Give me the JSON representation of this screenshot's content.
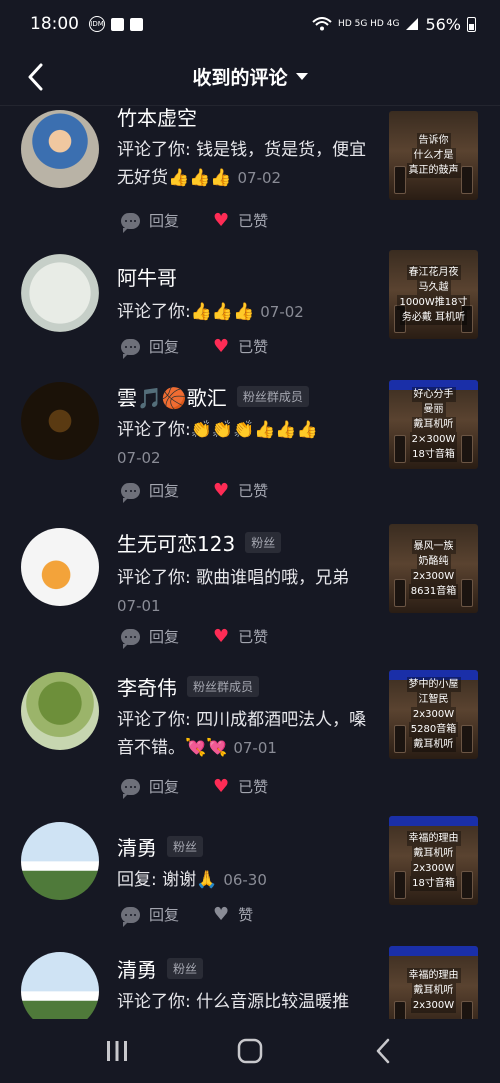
{
  "status_bar": {
    "time": "18:00",
    "network": "HD 5G HD 4G",
    "battery": "56%"
  },
  "header": {
    "title": "收到的评论"
  },
  "comments": [
    {
      "username": "竹本虚空",
      "tag": "",
      "text": "评论了你: 钱是钱，货是货，便宜无好货",
      "emoji": "👍👍👍",
      "date": "07-02",
      "reply_label": "回复",
      "like_label": "已赞",
      "liked": true,
      "thumb_lines": [
        "告诉你",
        "什么才是",
        "真正的鼓声"
      ]
    },
    {
      "username": "阿牛哥",
      "tag": "",
      "text": "评论了你:",
      "emoji": "👍👍👍",
      "date": "07-02",
      "reply_label": "回复",
      "like_label": "已赞",
      "liked": true,
      "thumb_lines": [
        "春江花月夜",
        "马久越",
        "1000W推18寸",
        "务必戴  耳机听"
      ]
    },
    {
      "username": "雲🎵🏀歌汇",
      "tag": "粉丝群成员",
      "text": "评论了你:",
      "emoji": "👏👏👏👍👍👍",
      "date": "07-02",
      "reply_label": "回复",
      "like_label": "已赞",
      "liked": true,
      "thumb_lines": [
        "好心分手",
        "曼丽",
        "戴耳机听",
        "2×300W",
        "18寸音箱"
      ]
    },
    {
      "username": "生无可恋123",
      "tag": "粉丝",
      "text": "评论了你: 歌曲谁唱的哦，兄弟",
      "emoji": "",
      "date": "07-01",
      "reply_label": "回复",
      "like_label": "已赞",
      "liked": true,
      "thumb_lines": [
        "暴风一族",
        "奶酪纯",
        "2x300W",
        "8631音箱"
      ]
    },
    {
      "username": "李奇伟",
      "tag": "粉丝群成员",
      "text": "评论了你: 四川成都酒吧法人，嗓音不错。",
      "emoji": "💘💘",
      "date": "07-01",
      "reply_label": "回复",
      "like_label": "已赞",
      "liked": true,
      "thumb_lines": [
        "梦中的小屋",
        "江智民",
        "2x300W",
        "5280音箱",
        "戴耳机听"
      ]
    },
    {
      "username": "清勇",
      "tag": "粉丝",
      "text": "回复: 谢谢",
      "emoji": "🙏",
      "date": "06-30",
      "reply_label": "回复",
      "like_label": "赞",
      "liked": false,
      "thumb_lines": [
        "幸福的理由",
        "",
        "戴耳机听",
        "2x300W",
        "18寸音箱"
      ]
    },
    {
      "username": "清勇",
      "tag": "粉丝",
      "text": "评论了你: 什么音源比较温暖推",
      "emoji": "",
      "date": "",
      "reply_label": "",
      "like_label": "",
      "liked": false,
      "thumb_lines": [
        "幸福的理由",
        "",
        "戴耳机听",
        "2x300W"
      ]
    }
  ],
  "colors": {
    "background": "#161823",
    "like_red": "#fe2c55",
    "muted": "#a4a6b0"
  },
  "icons": {
    "back": "chevron-left-icon",
    "reply": "comment-bubble-icon",
    "like": "heart-icon",
    "nav_recent": "recent-apps-icon",
    "nav_home": "home-icon",
    "nav_back": "back-icon"
  }
}
